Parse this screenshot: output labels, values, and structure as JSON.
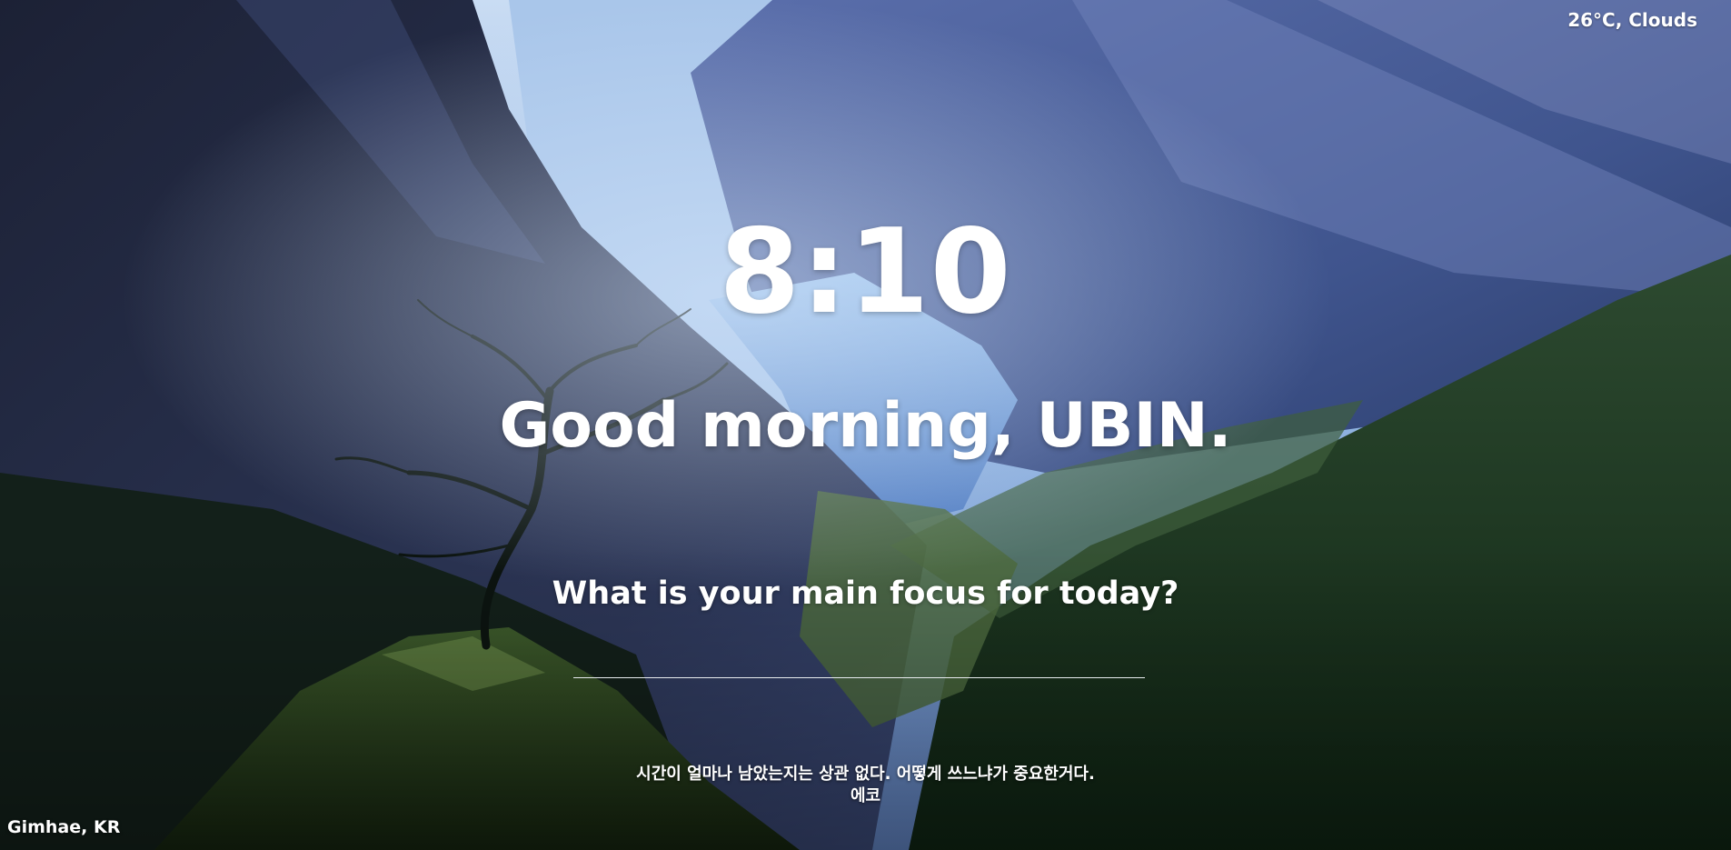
{
  "weather": {
    "text": "26°C, Clouds"
  },
  "clock": {
    "time": "8:10"
  },
  "greeting": {
    "text": "Good morning, UBIN."
  },
  "focus": {
    "question": "What is your main focus for today?",
    "value": "",
    "placeholder": ""
  },
  "quote": {
    "text": "시간이 얼마나 남았는지는 상관 없다. 어떻게 쓰느냐가 중요한거다.",
    "author": "에코"
  },
  "location": {
    "text": "Gimhae, KR"
  },
  "colors": {
    "text": "#ffffff",
    "sky": "#b8d3f0",
    "mountain_dark": "#1d2338",
    "mountain_mid": "#3f5690",
    "forest": "#1d3a22"
  }
}
